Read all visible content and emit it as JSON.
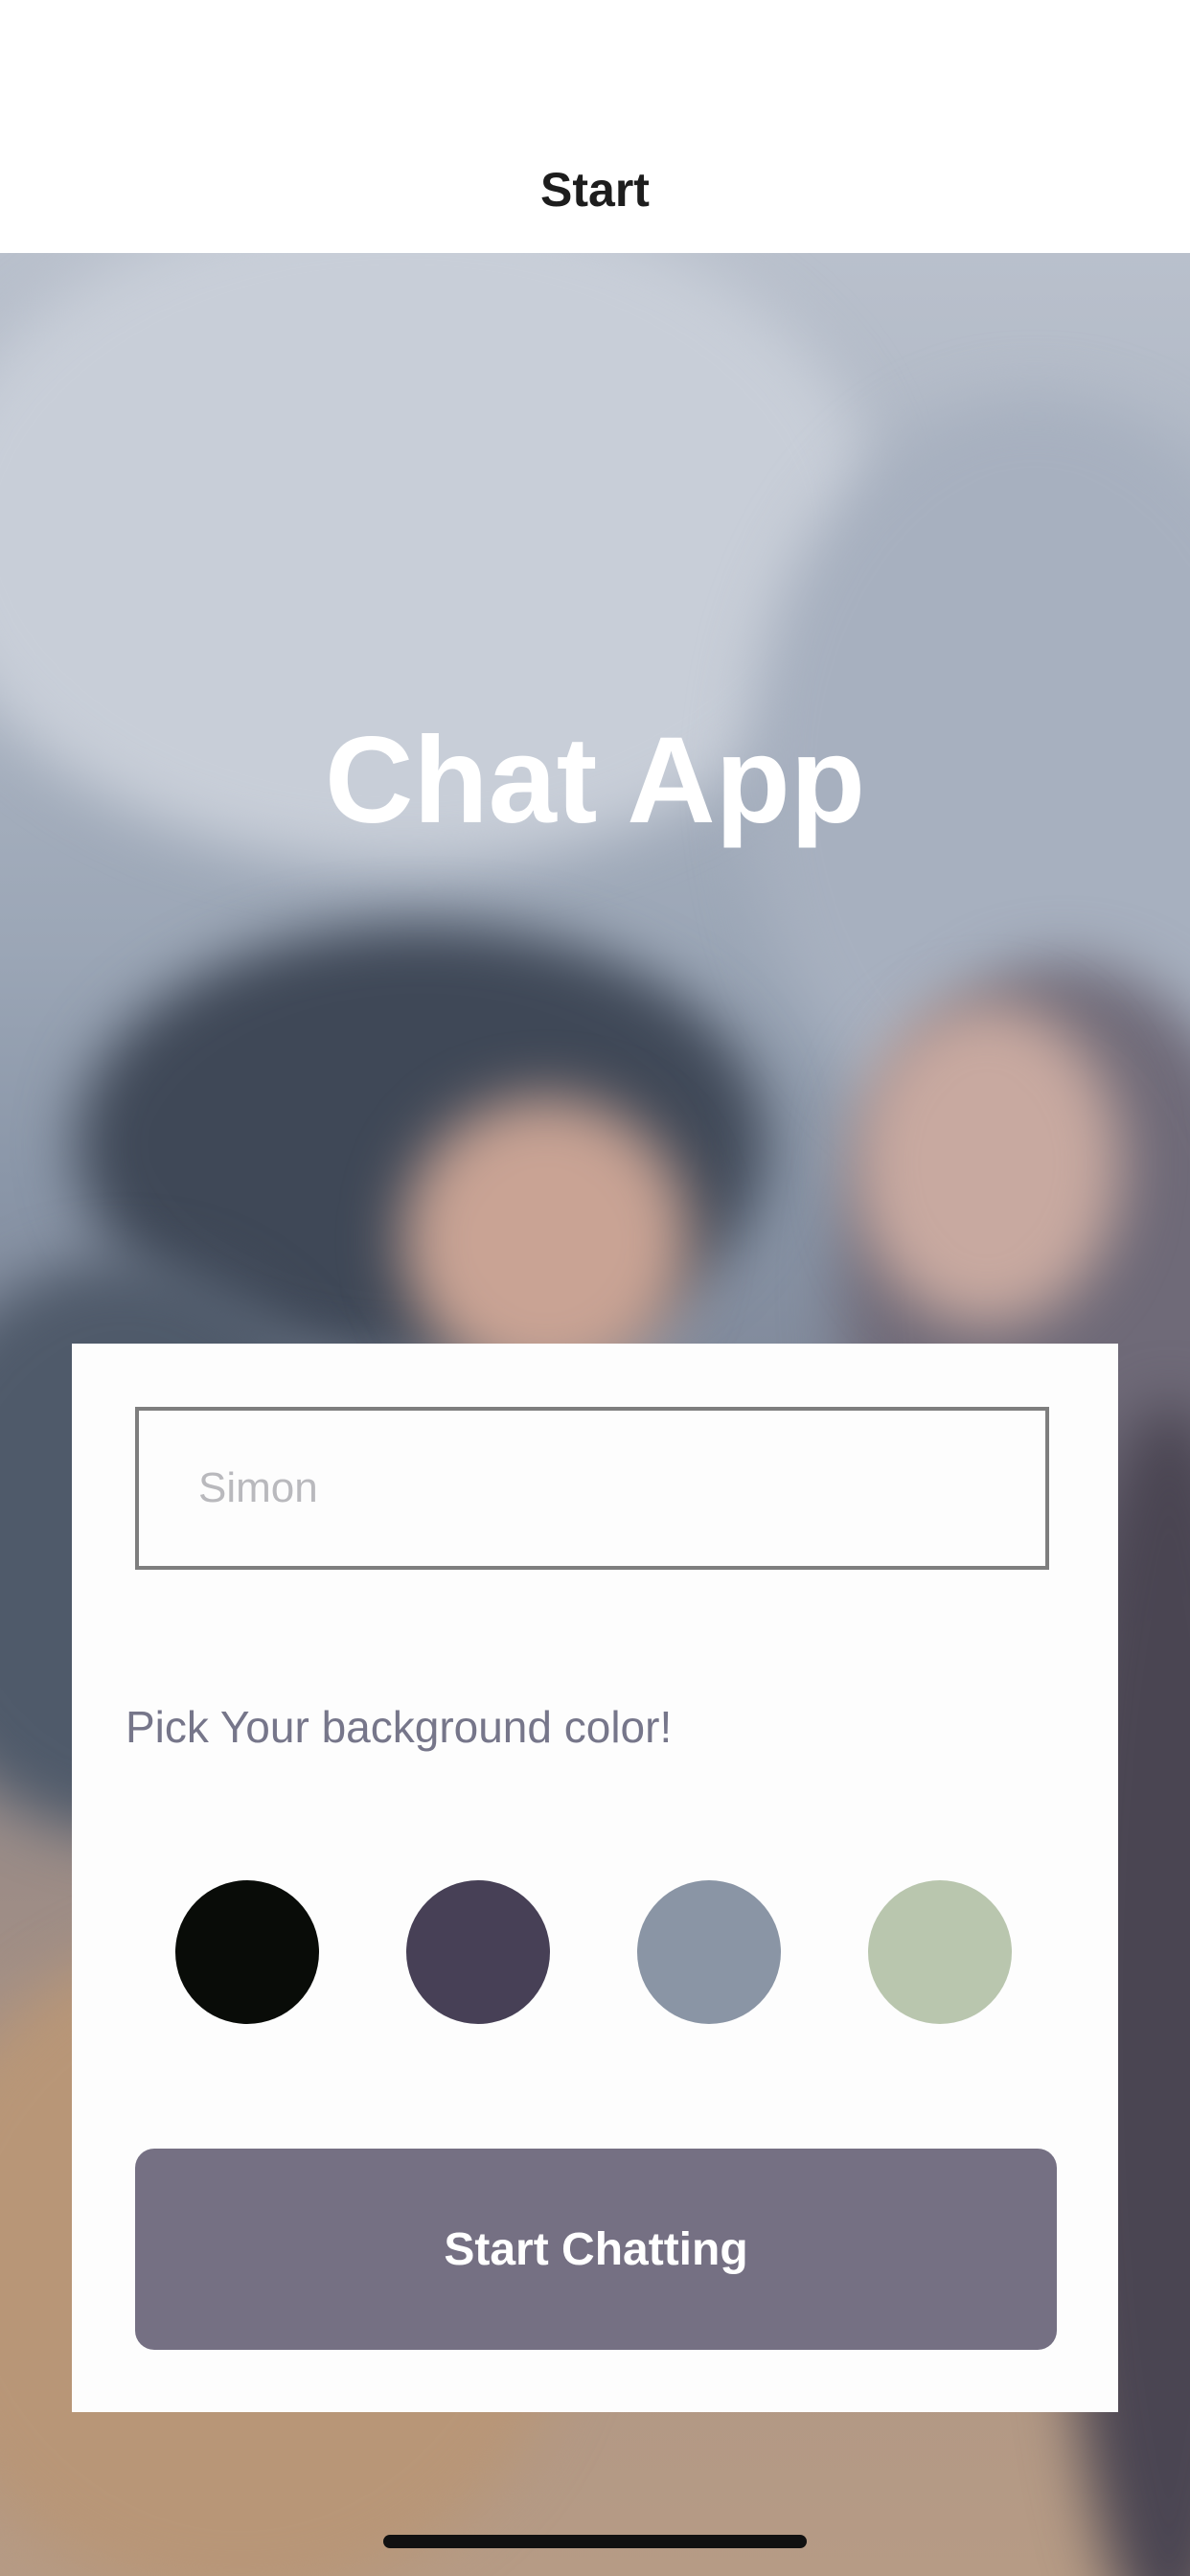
{
  "nav": {
    "title": "Start"
  },
  "hero": {
    "title": "Chat App"
  },
  "form": {
    "name_placeholder": "Simon",
    "name_value": "",
    "pick_label": "Pick Your background color!",
    "colors": [
      {
        "name": "black",
        "hex": "#090C08"
      },
      {
        "name": "purple",
        "hex": "#474056"
      },
      {
        "name": "grey-blue",
        "hex": "#8A95A5"
      },
      {
        "name": "sage-green",
        "hex": "#B9C6AE"
      }
    ],
    "button_label": "Start Chatting",
    "button_color": "#757083"
  }
}
